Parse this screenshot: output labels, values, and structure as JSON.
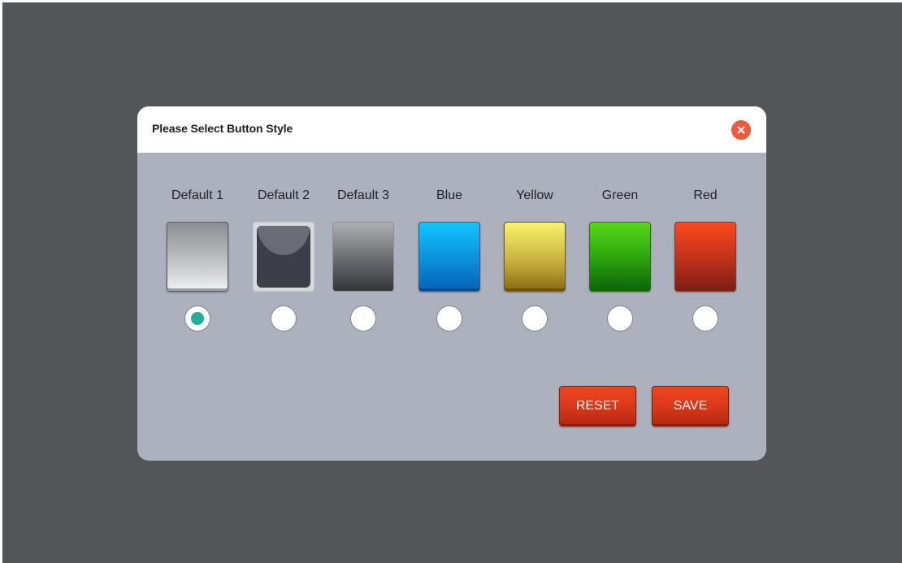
{
  "dialog": {
    "title": "Please Select Button Style"
  },
  "options": [
    {
      "label": "Default 1",
      "selected": true,
      "color": "#c4c5c8"
    },
    {
      "label": "Default 2",
      "selected": false,
      "color": "#3c3f47"
    },
    {
      "label": "Default 3",
      "selected": false,
      "color": "#6d6f74"
    },
    {
      "label": "Blue",
      "selected": false,
      "color": "#0a8fdc"
    },
    {
      "label": "Yellow",
      "selected": false,
      "color": "#c9b33f"
    },
    {
      "label": "Green",
      "selected": false,
      "color": "#2fa70e"
    },
    {
      "label": "Red",
      "selected": false,
      "color": "#c4331b"
    }
  ],
  "actions": {
    "reset_label": "RESET",
    "save_label": "SAVE"
  },
  "icons": {
    "close": "close-icon"
  },
  "colors": {
    "backdrop": "#545559",
    "dialog_body": "#acb1bd",
    "close_button": "#ef5a3b",
    "radio_selected": "#1eae9a",
    "action_button": "#d8371a"
  }
}
